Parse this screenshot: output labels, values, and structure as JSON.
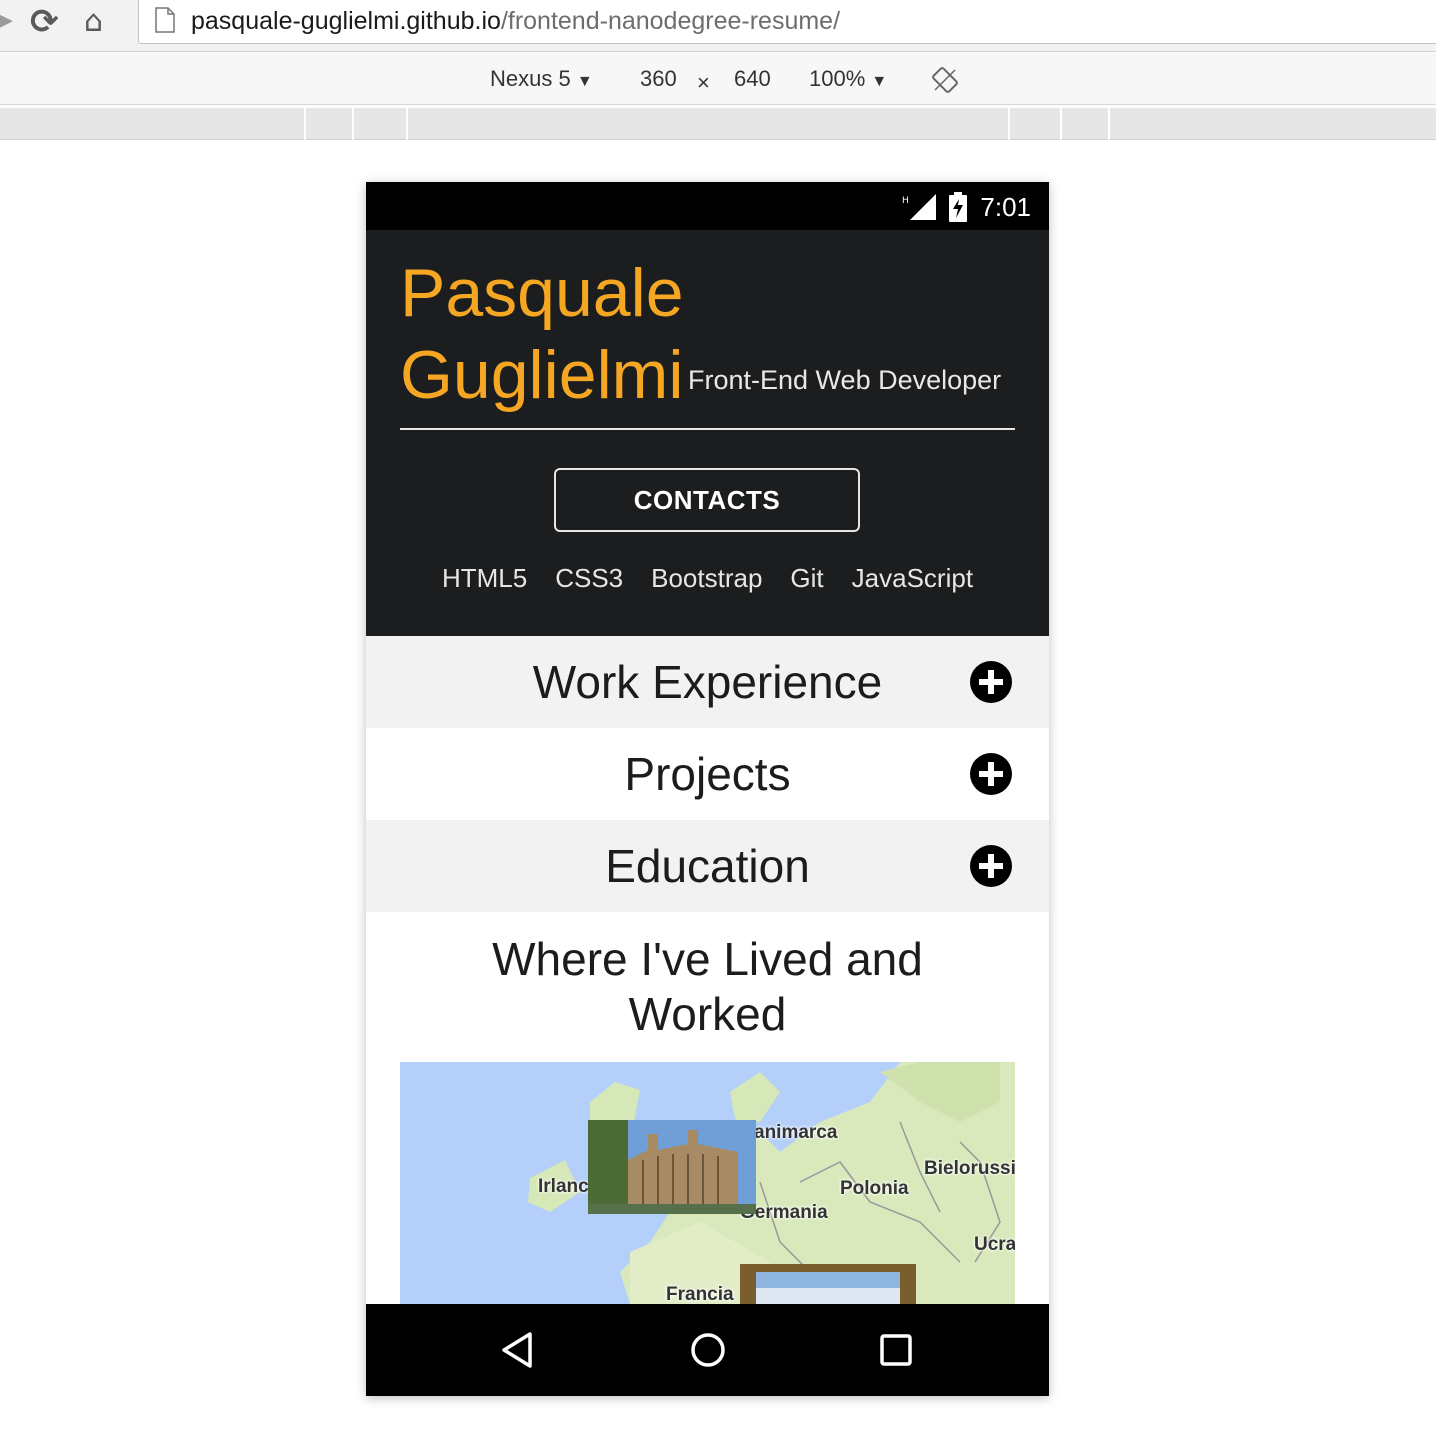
{
  "browser": {
    "url_host": "pasquale-guglielmi.github.io",
    "url_path": "/frontend-nanodegree-resume/"
  },
  "device_toolbar": {
    "device": "Nexus 5",
    "width": "360",
    "times": "×",
    "height": "640",
    "zoom": "100%"
  },
  "phone": {
    "status_time": "7:01",
    "header": {
      "name_line1": "Pasquale",
      "name_line2": "Guglielmi",
      "role": "Front-End Web Developer",
      "contacts_label": "CONTACTS",
      "skills": [
        "HTML5",
        "CSS3",
        "Bootstrap",
        "Git",
        "JavaScript"
      ]
    },
    "sections": [
      {
        "title": "Work Experience",
        "icon": "plus-circle-icon"
      },
      {
        "title": "Projects",
        "icon": "plus-circle-icon"
      },
      {
        "title": "Education",
        "icon": "plus-circle-icon"
      }
    ],
    "map": {
      "title_line1": "Where I've Lived and",
      "title_line2": "Worked",
      "labels": {
        "denmark": "animarca",
        "ireland": "Irlanc",
        "germany": "Germania",
        "poland": "Polonia",
        "belarus": "Bielorussi",
        "ukraine": "Ucra",
        "france": "Francia"
      }
    }
  },
  "colors": {
    "accent": "#f5a623",
    "header_bg": "#1b1d1e",
    "section_shade": "#f2f2f2"
  }
}
